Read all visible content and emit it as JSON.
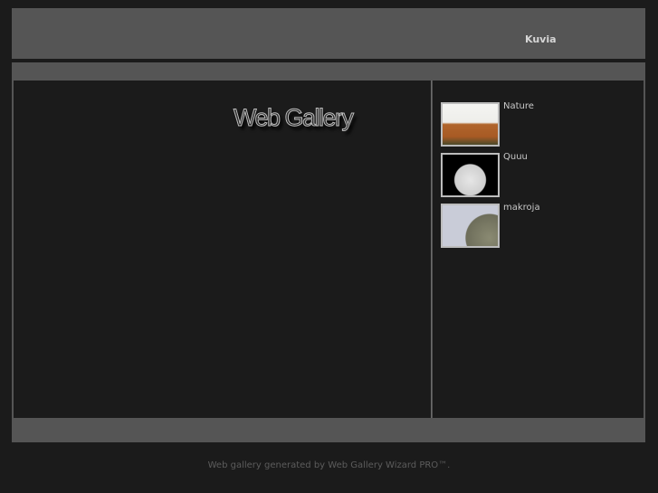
{
  "header": {
    "nav_link": "Kuvia"
  },
  "main": {
    "logo_text": "Web Gallery"
  },
  "albums": [
    {
      "label": "Nature",
      "thumb_icon": "forest-thumbnail"
    },
    {
      "label": "Quuu",
      "thumb_icon": "moon-thumbnail"
    },
    {
      "label": "makroja",
      "thumb_icon": "coin-thumbnail"
    }
  ],
  "footer": {
    "text": "Web gallery generated by Web Gallery Wizard PRO™."
  }
}
